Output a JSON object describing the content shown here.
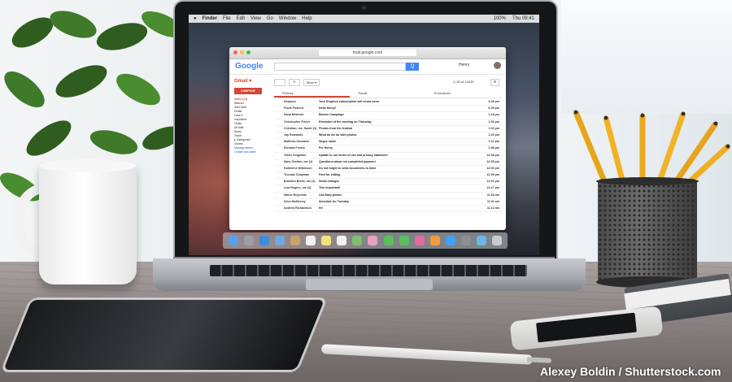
{
  "credit": "Alexey Boldin / Shutterstock.com",
  "menubar": {
    "apple": "",
    "items": [
      "Finder",
      "File",
      "Edit",
      "View",
      "Go",
      "Window",
      "Help"
    ],
    "battery": "100%",
    "clock": "Thu 09:41"
  },
  "browser": {
    "url": "mail.google.com",
    "logo": "Google",
    "search_button": "Q",
    "user": "Henry"
  },
  "gmail": {
    "label": "Gmail ▾",
    "compose": "COMPOSE",
    "nav": [
      "Inbox (11)",
      "Starred",
      "Sent Mail",
      "Drafts",
      "Less ▾",
      "Important",
      "Chats",
      "All Mail",
      "Spam",
      "Trash",
      "▸ Categories",
      "Circles",
      "Manage labels",
      "Create new label"
    ],
    "toolbar": {
      "more": "More ▾",
      "range": "1–50 of 14235"
    },
    "tabs": [
      "Primary",
      "Social",
      "Promotions"
    ],
    "rows": [
      {
        "sender": "Dropbox",
        "subject": "Your Dropbox subscription will renew soon",
        "time": "3:45 pm"
      },
      {
        "sender": "Frank Fletcher",
        "subject": "Hello Henry!",
        "time": "6:25 pm"
      },
      {
        "sender": "Dana Niwinski",
        "subject": "Banner Campaign",
        "time": "1:18 pm"
      },
      {
        "sender": "Christopher Fisher",
        "subject": "Reminder of the meeting on Thursday",
        "time": "1:53 pm"
      },
      {
        "sender": "Christian, me, Sarah (3)",
        "subject": "Photos from the festival",
        "time": "1:32 pm"
      },
      {
        "sender": "Jay Romando",
        "subject": "What do we do with photos",
        "time": "1:20 pm"
      },
      {
        "sender": "Matthew Gonzales",
        "subject": "Skype name",
        "time": "1:12 pm"
      },
      {
        "sender": "Richard French",
        "subject": "For Henry",
        "time": "1:08 pm"
      },
      {
        "sender": "Oliver Singleton",
        "subject": "Update to our terms of use and privacy statement",
        "time": "12:58 pm"
      },
      {
        "sender": "Mary Shelton, me (2)",
        "subject": "Questions about not completed payment",
        "time": "12:55 pm"
      },
      {
        "sender": "Katherine Wilkinson",
        "subject": "Do not forget to send documents to Dave",
        "time": "12:50 pm"
      },
      {
        "sender": "Thomas Chapman",
        "subject": "Font for editing",
        "time": "12:39 pm"
      },
      {
        "sender": "Brandon Burke, me (2)",
        "subject": "Small changes",
        "time": "12:21 pm"
      },
      {
        "sender": "Lisa Rogers, me (3)",
        "subject": "This important!",
        "time": "12:17 pm"
      },
      {
        "sender": "Marco Reynolds",
        "subject": "Call Mary please",
        "time": "11:52 am"
      },
      {
        "sender": "Alice McKinney",
        "subject": "Schedule for Tuesday",
        "time": "11:32 am"
      },
      {
        "sender": "Andrew Richardson",
        "subject": "Hi!",
        "time": "11:12 am"
      }
    ]
  },
  "colors": {
    "gmail_red": "#d14836",
    "google_blue": "#4285f4"
  },
  "dock_icons": [
    "finder-icon",
    "launchpad-icon",
    "safari-icon",
    "mail-icon",
    "contacts-icon",
    "calendar-icon",
    "notes-icon",
    "reminders-icon",
    "maps-icon",
    "photos-icon",
    "messages-icon",
    "facetime-icon",
    "itunes-icon",
    "ibooks-icon",
    "appstore-icon",
    "systemprefs-icon",
    "downloads-icon",
    "trash-icon"
  ]
}
